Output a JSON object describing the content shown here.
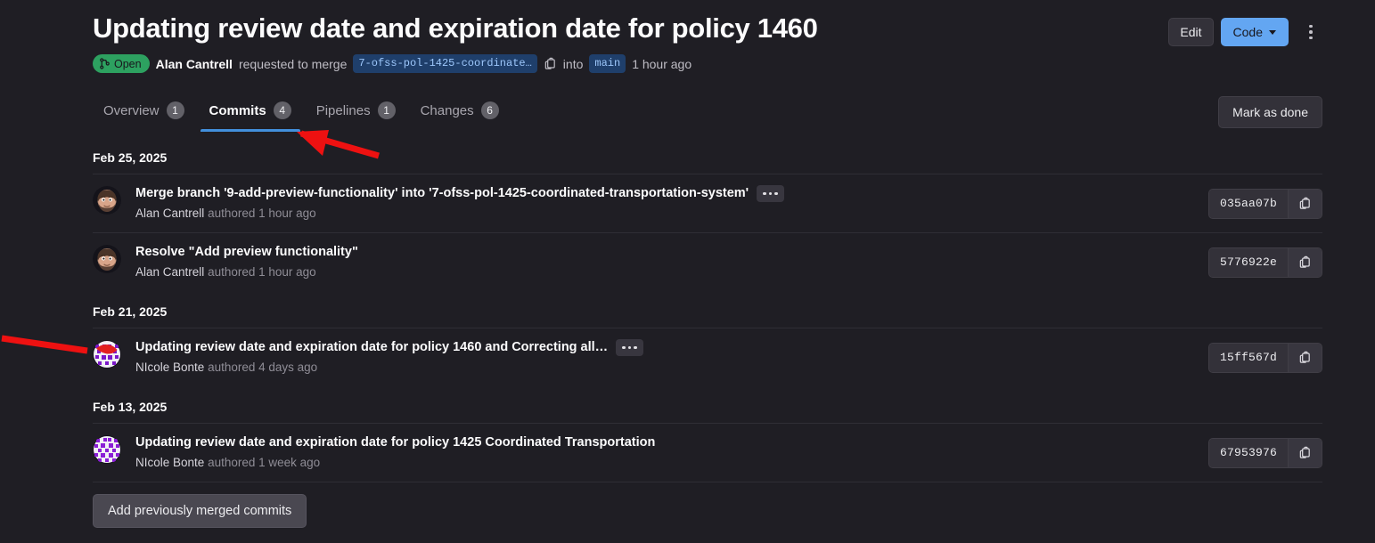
{
  "header": {
    "title": "Updating review date and expiration date for policy 1460",
    "edit_label": "Edit",
    "code_label": "Code",
    "more_actions_name": "More actions"
  },
  "status": {
    "state_label": "Open",
    "author": "Alan Cantrell",
    "requested_text": "requested to merge",
    "source_branch": "7-ofss-pol-1425-coordinate…",
    "into_text": "into",
    "target_branch": "main",
    "time": "1 hour ago"
  },
  "tabs": [
    {
      "label": "Overview",
      "count": "1",
      "active": false
    },
    {
      "label": "Commits",
      "count": "4",
      "active": true
    },
    {
      "label": "Pipelines",
      "count": "1",
      "active": false
    },
    {
      "label": "Changes",
      "count": "6",
      "active": false
    }
  ],
  "mark_as_done_label": "Mark as done",
  "commit_groups": [
    {
      "date": "Feb 25, 2025",
      "commits": [
        {
          "title": "Merge branch '9-add-preview-functionality' into '7-ofss-pol-1425-coordinated-transportation-system'",
          "has_ellipsis": true,
          "author": "Alan Cantrell",
          "authored_text": "authored",
          "time": "1 hour ago",
          "sha": "035aa07b",
          "avatar": "alan"
        },
        {
          "title": "Resolve \"Add preview functionality\"",
          "has_ellipsis": false,
          "author": "Alan Cantrell",
          "authored_text": "authored",
          "time": "1 hour ago",
          "sha": "5776922e",
          "avatar": "alan"
        }
      ]
    },
    {
      "date": "Feb 21, 2025",
      "commits": [
        {
          "title": "Updating review date and expiration date for policy 1460 and Correcting all…",
          "has_ellipsis": true,
          "author": "NIcole Bonte",
          "authored_text": "authored",
          "time": "4 days ago",
          "sha": "15ff567d",
          "avatar": "nicole-red"
        }
      ]
    },
    {
      "date": "Feb 13, 2025",
      "commits": [
        {
          "title": "Updating review date and expiration date for policy 1425 Coordinated Transportation",
          "has_ellipsis": false,
          "author": "NIcole Bonte",
          "authored_text": "authored",
          "time": "1 week ago",
          "sha": "67953976",
          "avatar": "nicole-purple"
        }
      ]
    }
  ],
  "add_previously_merged_label": "Add previously merged commits",
  "colors": {
    "background": "#1f1e24",
    "accent_blue": "#428fdc",
    "code_button": "#63a6f2",
    "open_green": "#2da160",
    "annotation_red": "#ee1111"
  }
}
